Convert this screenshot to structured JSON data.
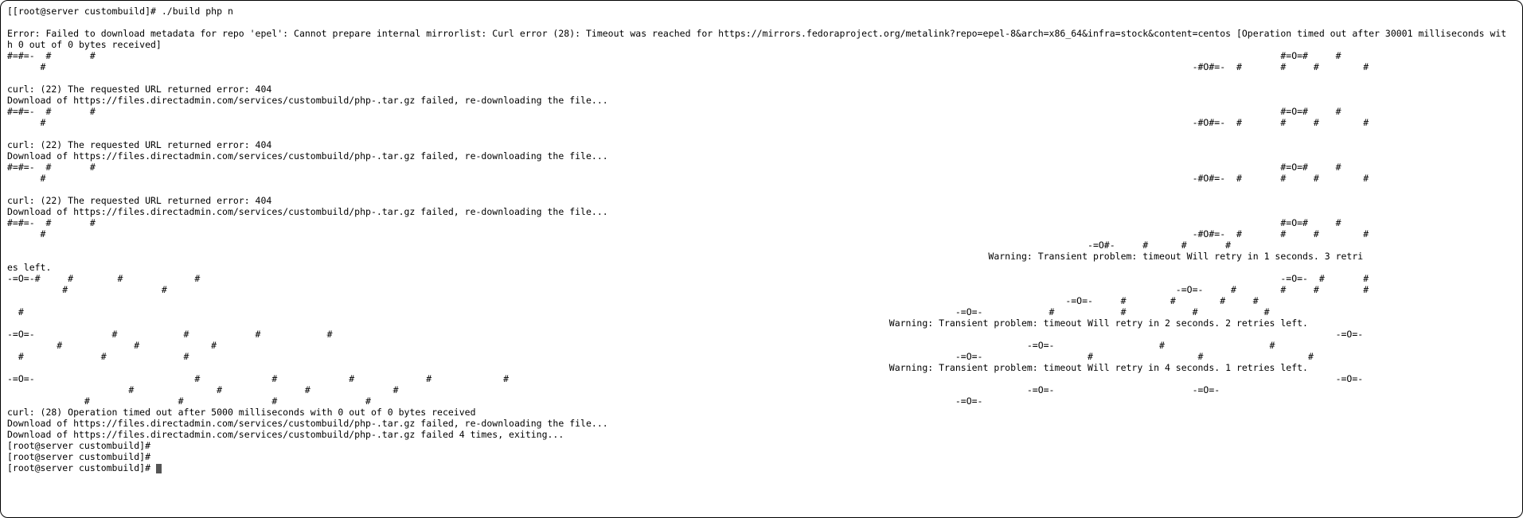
{
  "terminal": {
    "lines": [
      "[[root@server custombuild]# ./build php n",
      "",
      "Error: Failed to download metadata for repo 'epel': Cannot prepare internal mirrorlist: Curl error (28): Timeout was reached for https://mirrors.fedoraproject.org/metalink?repo=epel-8&arch=x86_64&infra=stock&content=centos [Operation timed out after 30001 milliseconds wit",
      "h 0 out of 0 bytes received]",
      "#=#=-  #       #                                                                                                                                                                                                                       #=O=#     #",
      "      #                                                                                                                                                                                                                -#O#=-  #       #     #        #",
      "",
      "curl: (22) The requested URL returned error: 404",
      "Download of https://files.directadmin.com/services/custombuild/php-.tar.gz failed, re-downloading the file...",
      "#=#=-  #       #                                                                                                                                                                                                                       #=O=#     #",
      "      #                                                                                                                                                                                                                -#O#=-  #       #     #        #",
      "",
      "curl: (22) The requested URL returned error: 404",
      "Download of https://files.directadmin.com/services/custombuild/php-.tar.gz failed, re-downloading the file...",
      "#=#=-  #       #                                                                                                                                                                                                                       #=O=#     #",
      "      #                                                                                                                                                                                                                -#O#=-  #       #     #        #",
      "",
      "curl: (22) The requested URL returned error: 404",
      "Download of https://files.directadmin.com/services/custombuild/php-.tar.gz failed, re-downloading the file...",
      "#=#=-  #       #                                                                                                                                                                                                                       #=O=#     #",
      "      #                                                                                                                                                                                                                -#O#=-  #       #     #        #",
      "                                                                                                                                                                                                    -=O#-     #      #       #",
      "                                                                                                                                                                                  Warning: Transient problem: timeout Will retry in 1 seconds. 3 retri",
      "es left.",
      "-=O=-#     #        #             #                                                                                                                                                                                                    -=O=-  #       #",
      "          #                 #                                                                                                                                                                                       -=O=-     #        #     #        #",
      "                                                                                                                                                                                                -=O=-     #        #        #     #",
      "  #                                                                                                                                                                         -=O=-            #            #            #            #",
      "                                                                                                                                                                Warning: Transient problem: timeout Will retry in 2 seconds. 2 retries left.",
      "-=O=-              #            #            #            #                                                                                                                                                                                      -=O=-",
      "         #             #             #                                                                                                                                                   -=O=-                   #                   #",
      "  #              #              #                                                                                                                                           -=O=-                   #                   #                   #",
      "                                                                                                                                                                Warning: Transient problem: timeout Will retry in 4 seconds. 1 retries left.",
      "-=O=-                             #             #             #             #             #                                                                                                                                                      -=O=-",
      "                      #               #               #               #                                                                                                                  -=O=-                         -=O=-",
      "              #                #                #                #                                                                                                          -=O=-",
      "curl: (28) Operation timed out after 5000 milliseconds with 0 out of 0 bytes received",
      "Download of https://files.directadmin.com/services/custombuild/php-.tar.gz failed, re-downloading the file...",
      "Download of https://files.directadmin.com/services/custombuild/php-.tar.gz failed 4 times, exiting...",
      "[root@server custombuild]#",
      "[root@server custombuild]#",
      "[root@server custombuild]# "
    ]
  }
}
